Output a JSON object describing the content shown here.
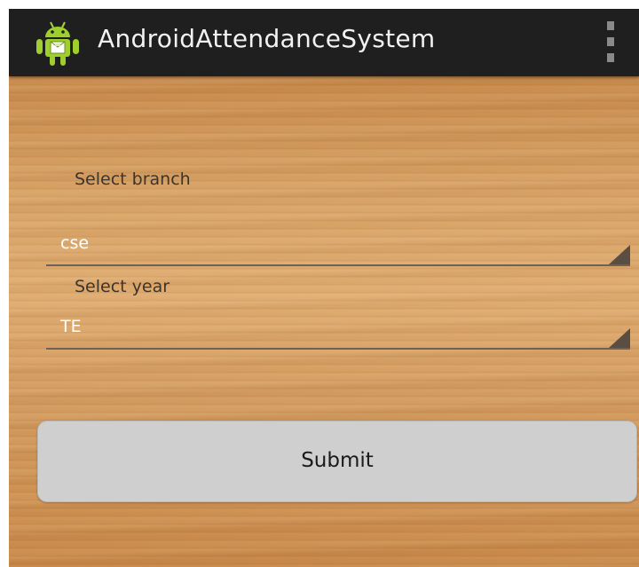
{
  "action_bar": {
    "title": "AndroidAttendanceSystem",
    "app_icon": "android-robot-icon",
    "overflow_icon": "overflow-menu-icon",
    "background_color": "#1f1f1f"
  },
  "form": {
    "branch": {
      "label": "Select branch",
      "selected_value": "cse"
    },
    "year": {
      "label": "Select year",
      "selected_value": "TE"
    },
    "submit_label": "Submit"
  },
  "colors": {
    "android_green": "#9fcf2e",
    "wood_background": "#d39a5c",
    "button_background": "#cfcfcf"
  }
}
